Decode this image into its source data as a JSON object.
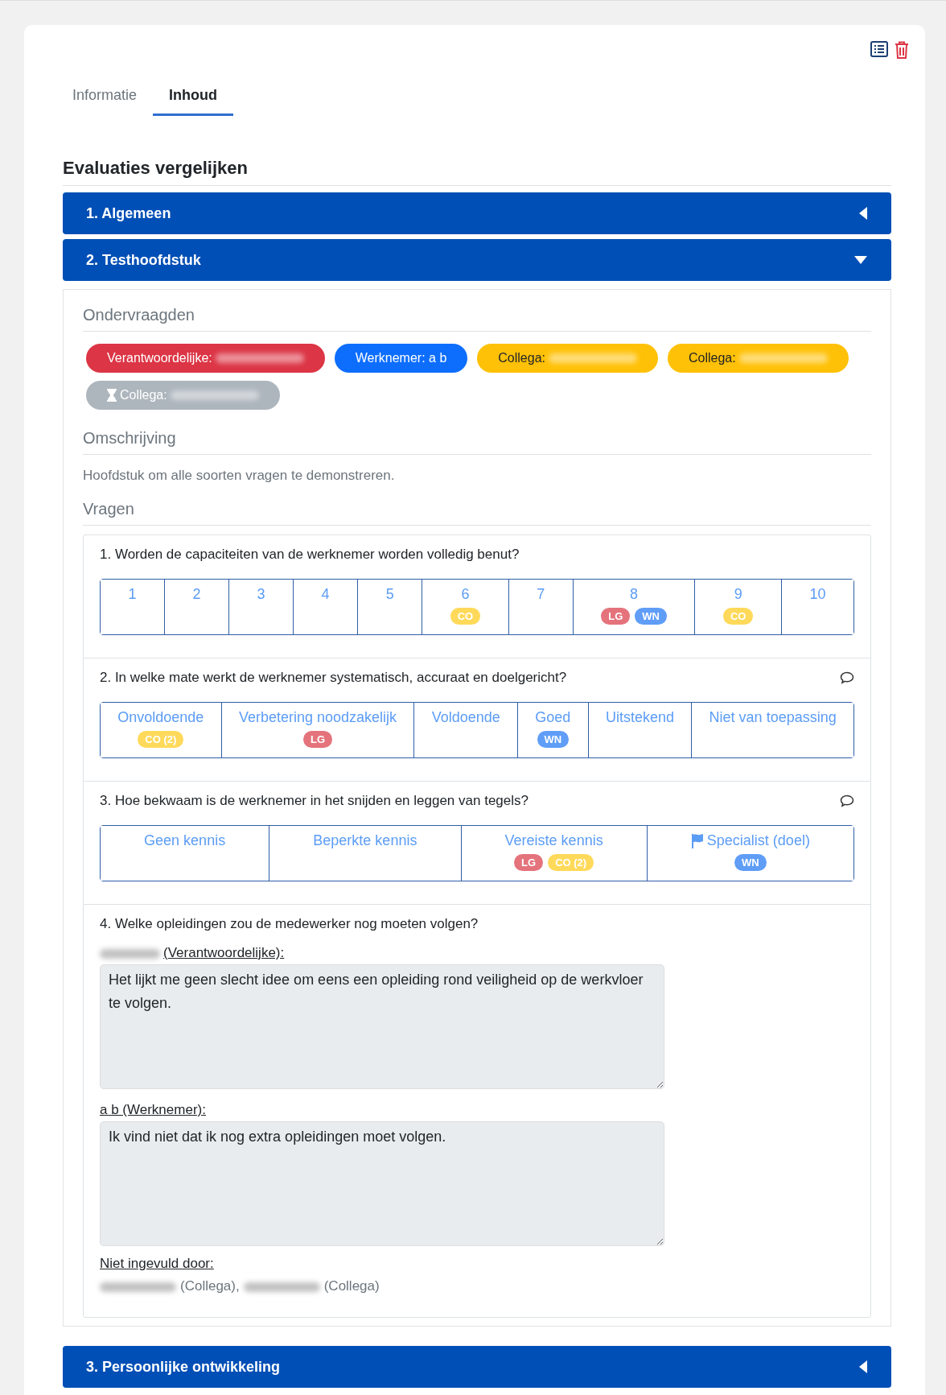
{
  "tabs": [
    {
      "label": "Informatie",
      "selected": false
    },
    {
      "label": "Inhoud",
      "selected": true
    }
  ],
  "title": "Evaluaties vergelijken",
  "chapters_before": [
    {
      "title": "1. Algemeen",
      "expanded": false
    }
  ],
  "chapter": {
    "title": "2. Testhoofdstuk",
    "expanded": true,
    "respondents_heading": "Ondervraagden",
    "respondents": [
      {
        "label": "Verantwoordelijke:",
        "color": "#dc3545",
        "pending": false,
        "name_hidden": true
      },
      {
        "label": "Werknemer: a b",
        "color": "#0d6efd",
        "pending": false
      },
      {
        "label": "Collega:",
        "color": "#ffc107",
        "pending": false,
        "name_hidden": true
      },
      {
        "label": "Collega:",
        "color": "#ffc107",
        "pending": false,
        "name_hidden": true
      },
      {
        "label": "Collega:",
        "color": "#adb5bd",
        "pending": true,
        "name_hidden": true
      }
    ],
    "description_heading": "Omschrijving",
    "description": "Hoofdstuk om alle soorten vragen te demonstreren.",
    "questions_heading": "Vragen",
    "questions": [
      {
        "kind": "scale",
        "text": "1. Worden de capaciteiten van de werknemer worden volledig benut?",
        "options": [
          {
            "label": "1"
          },
          {
            "label": "2"
          },
          {
            "label": "3"
          },
          {
            "label": "4"
          },
          {
            "label": "5"
          },
          {
            "label": "6",
            "badges": [
              {
                "text": "CO",
                "color": "#ffd95a"
              }
            ]
          },
          {
            "label": "7"
          },
          {
            "label": "8",
            "badges": [
              {
                "text": "LG",
                "color": "#e4737c"
              },
              {
                "text": "WN",
                "color": "#5f9df7"
              }
            ]
          },
          {
            "label": "9",
            "badges": [
              {
                "text": "CO",
                "color": "#ffd95a"
              }
            ]
          },
          {
            "label": "10"
          }
        ]
      },
      {
        "kind": "scale",
        "text": "2. In welke mate werkt de werknemer systematisch, accuraat en doelgericht?",
        "has_comment": true,
        "options": [
          {
            "label": "Onvoldoende",
            "badges": [
              {
                "text": "CO (2)",
                "color": "#ffd95a"
              }
            ]
          },
          {
            "label": "Verbetering noodzakelijk",
            "badges": [
              {
                "text": "LG",
                "color": "#e4737c"
              }
            ]
          },
          {
            "label": "Voldoende"
          },
          {
            "label": "Goed",
            "badges": [
              {
                "text": "WN",
                "color": "#5f9df7"
              }
            ]
          },
          {
            "label": "Uitstekend"
          },
          {
            "label": "Niet van toepassing"
          }
        ]
      },
      {
        "kind": "scale",
        "text": "3. Hoe bekwaam is de werknemer in het snijden en leggen van tegels?",
        "has_comment": true,
        "options": [
          {
            "label": "Geen kennis"
          },
          {
            "label": "Beperkte kennis"
          },
          {
            "label": "Vereiste kennis",
            "badges": [
              {
                "text": "LG",
                "color": "#e4737c"
              },
              {
                "text": "CO (2)",
                "color": "#ffd95a"
              }
            ]
          },
          {
            "label": "Specialist (doel)",
            "flag": true,
            "badges": [
              {
                "text": "WN",
                "color": "#5f9df7"
              }
            ]
          }
        ]
      },
      {
        "kind": "open",
        "text": "4. Welke opleidingen zou de medewerker nog moeten volgen?",
        "answers": [
          {
            "label": "(Verantwoordelijke):",
            "name_hidden": true,
            "value": "Het lijkt me geen slecht idee om eens een opleiding rond veiligheid op de werkvloer te volgen."
          },
          {
            "label": "a b (Werknemer):",
            "value": "Ik vind niet dat ik nog extra opleidingen moet volgen."
          }
        ],
        "missing_heading": "Niet ingevuld door:",
        "missing": [
          {
            "role": "(Collega),",
            "name_hidden": true
          },
          {
            "role": "(Collega)",
            "name_hidden": true
          }
        ]
      }
    ]
  },
  "chapters_after": [
    {
      "title": "3. Persoonlijke ontwikkeling",
      "expanded": false
    }
  ]
}
